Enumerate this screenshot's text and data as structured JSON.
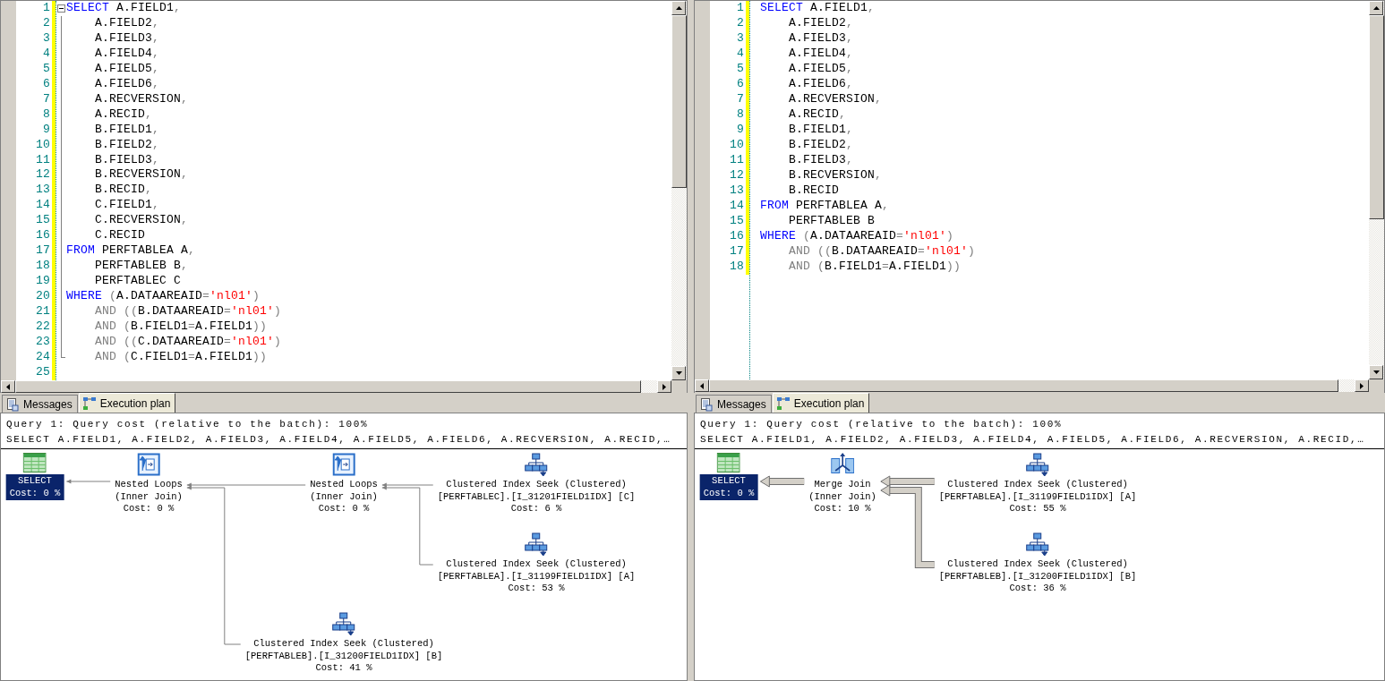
{
  "panes": [
    {
      "editor": {
        "outlining": true,
        "lines": [
          {
            "number": "1",
            "tokens": [
              {
                "kind": "keyword",
                "text": "SELECT"
              },
              {
                "kind": "identifier",
                "text": " A.FIELD1"
              },
              {
                "kind": "punctuation",
                "text": ","
              }
            ]
          },
          {
            "number": "2",
            "tokens": [
              {
                "kind": "identifier",
                "text": "    A.FIELD2"
              },
              {
                "kind": "punctuation",
                "text": ","
              }
            ]
          },
          {
            "number": "3",
            "tokens": [
              {
                "kind": "identifier",
                "text": "    A.FIELD3"
              },
              {
                "kind": "punctuation",
                "text": ","
              }
            ]
          },
          {
            "number": "4",
            "tokens": [
              {
                "kind": "identifier",
                "text": "    A.FIELD4"
              },
              {
                "kind": "punctuation",
                "text": ","
              }
            ]
          },
          {
            "number": "5",
            "tokens": [
              {
                "kind": "identifier",
                "text": "    A.FIELD5"
              },
              {
                "kind": "punctuation",
                "text": ","
              }
            ]
          },
          {
            "number": "6",
            "tokens": [
              {
                "kind": "identifier",
                "text": "    A.FIELD6"
              },
              {
                "kind": "punctuation",
                "text": ","
              }
            ]
          },
          {
            "number": "7",
            "tokens": [
              {
                "kind": "identifier",
                "text": "    A.RECVERSION"
              },
              {
                "kind": "punctuation",
                "text": ","
              }
            ]
          },
          {
            "number": "8",
            "tokens": [
              {
                "kind": "identifier",
                "text": "    A.RECID"
              },
              {
                "kind": "punctuation",
                "text": ","
              }
            ]
          },
          {
            "number": "9",
            "tokens": [
              {
                "kind": "identifier",
                "text": "    B.FIELD1"
              },
              {
                "kind": "punctuation",
                "text": ","
              }
            ]
          },
          {
            "number": "10",
            "tokens": [
              {
                "kind": "identifier",
                "text": "    B.FIELD2"
              },
              {
                "kind": "punctuation",
                "text": ","
              }
            ]
          },
          {
            "number": "11",
            "tokens": [
              {
                "kind": "identifier",
                "text": "    B.FIELD3"
              },
              {
                "kind": "punctuation",
                "text": ","
              }
            ]
          },
          {
            "number": "12",
            "tokens": [
              {
                "kind": "identifier",
                "text": "    B.RECVERSION"
              },
              {
                "kind": "punctuation",
                "text": ","
              }
            ]
          },
          {
            "number": "13",
            "tokens": [
              {
                "kind": "identifier",
                "text": "    B.RECID"
              },
              {
                "kind": "punctuation",
                "text": ","
              }
            ]
          },
          {
            "number": "14",
            "tokens": [
              {
                "kind": "identifier",
                "text": "    C.FIELD1"
              },
              {
                "kind": "punctuation",
                "text": ","
              }
            ]
          },
          {
            "number": "15",
            "tokens": [
              {
                "kind": "identifier",
                "text": "    C.RECVERSION"
              },
              {
                "kind": "punctuation",
                "text": ","
              }
            ]
          },
          {
            "number": "16",
            "tokens": [
              {
                "kind": "identifier",
                "text": "    C.RECID"
              }
            ]
          },
          {
            "number": "17",
            "tokens": [
              {
                "kind": "keyword",
                "text": "FROM"
              },
              {
                "kind": "identifier",
                "text": " PERFTABLEA A"
              },
              {
                "kind": "punctuation",
                "text": ","
              }
            ]
          },
          {
            "number": "18",
            "tokens": [
              {
                "kind": "identifier",
                "text": "    PERFTABLEB B"
              },
              {
                "kind": "punctuation",
                "text": ","
              }
            ]
          },
          {
            "number": "19",
            "tokens": [
              {
                "kind": "identifier",
                "text": "    PERFTABLEC C"
              }
            ]
          },
          {
            "number": "20",
            "tokens": [
              {
                "kind": "keyword",
                "text": "WHERE"
              },
              {
                "kind": "punctuation",
                "text": " ("
              },
              {
                "kind": "identifier",
                "text": "A.DATAAREAID"
              },
              {
                "kind": "punctuation",
                "text": "="
              },
              {
                "kind": "string",
                "text": "'nl01'"
              },
              {
                "kind": "punctuation",
                "text": ")"
              }
            ]
          },
          {
            "number": "21",
            "tokens": [
              {
                "kind": "operator",
                "text": "    AND"
              },
              {
                "kind": "punctuation",
                "text": " (("
              },
              {
                "kind": "identifier",
                "text": "B.DATAAREAID"
              },
              {
                "kind": "punctuation",
                "text": "="
              },
              {
                "kind": "string",
                "text": "'nl01'"
              },
              {
                "kind": "punctuation",
                "text": ")"
              }
            ]
          },
          {
            "number": "22",
            "tokens": [
              {
                "kind": "operator",
                "text": "    AND"
              },
              {
                "kind": "punctuation",
                "text": " ("
              },
              {
                "kind": "identifier",
                "text": "B.FIELD1"
              },
              {
                "kind": "punctuation",
                "text": "="
              },
              {
                "kind": "identifier",
                "text": "A.FIELD1"
              },
              {
                "kind": "punctuation",
                "text": "))"
              }
            ]
          },
          {
            "number": "23",
            "tokens": [
              {
                "kind": "operator",
                "text": "    AND"
              },
              {
                "kind": "punctuation",
                "text": " (("
              },
              {
                "kind": "identifier",
                "text": "C.DATAAREAID"
              },
              {
                "kind": "punctuation",
                "text": "="
              },
              {
                "kind": "string",
                "text": "'nl01'"
              },
              {
                "kind": "punctuation",
                "text": ")"
              }
            ]
          },
          {
            "number": "24",
            "tokens": [
              {
                "kind": "operator",
                "text": "    AND"
              },
              {
                "kind": "punctuation",
                "text": " ("
              },
              {
                "kind": "identifier",
                "text": "C.FIELD1"
              },
              {
                "kind": "punctuation",
                "text": "="
              },
              {
                "kind": "identifier",
                "text": "A.FIELD1"
              },
              {
                "kind": "punctuation",
                "text": "))"
              }
            ]
          },
          {
            "number": "25"
          }
        ]
      },
      "results": {
        "tabs": [
          {
            "label": "Messages",
            "kind": "messages",
            "selected": false
          },
          {
            "label": "Execution plan",
            "kind": "plan",
            "selected": true
          }
        ],
        "header": "Query 1: Query cost (relative to the batch): 100%",
        "statement": "SELECT A.FIELD1, A.FIELD2, A.FIELD3, A.FIELD4, A.FIELD5, A.FIELD6, A.RECVERSION, A.RECID,…",
        "plan": {
          "wide_arrows": false,
          "root": {
            "kind": "select",
            "lines": [
              "SELECT"
            ],
            "cost": "Cost: 0 %",
            "selected": true,
            "children": [
              {
                "kind": "nested_loops",
                "lines": [
                  "Nested Loops",
                  "(Inner Join)"
                ],
                "cost": "Cost: 0 %",
                "selected": false,
                "children": [
                  {
                    "kind": "nested_loops",
                    "lines": [
                      "Nested Loops",
                      "(Inner Join)"
                    ],
                    "cost": "Cost: 0 %",
                    "selected": false,
                    "children": [
                      {
                        "kind": "index_seek",
                        "lines": [
                          "Clustered Index Seek (Clustered)",
                          "[PERFTABLEC].[I_31201FIELD1IDX] [C]"
                        ],
                        "cost": "Cost: 6 %",
                        "selected": false
                      },
                      {
                        "kind": "index_seek",
                        "lines": [
                          "Clustered Index Seek (Clustered)",
                          "[PERFTABLEA].[I_31199FIELD1IDX] [A]"
                        ],
                        "cost": "Cost: 53 %",
                        "selected": false
                      }
                    ]
                  },
                  {
                    "kind": "index_seek",
                    "lines": [
                      "Clustered Index Seek (Clustered)",
                      "[PERFTABLEB].[I_31200FIELD1IDX] [B]"
                    ],
                    "cost": "Cost: 41 %",
                    "selected": false
                  }
                ]
              }
            ]
          }
        }
      }
    },
    {
      "editor": {
        "outlining": false,
        "lines": [
          {
            "number": "1",
            "tokens": [
              {
                "kind": "keyword",
                "text": "SELECT"
              },
              {
                "kind": "identifier",
                "text": " A.FIELD1"
              },
              {
                "kind": "punctuation",
                "text": ","
              }
            ]
          },
          {
            "number": "2",
            "tokens": [
              {
                "kind": "identifier",
                "text": "    A.FIELD2"
              },
              {
                "kind": "punctuation",
                "text": ","
              }
            ]
          },
          {
            "number": "3",
            "tokens": [
              {
                "kind": "identifier",
                "text": "    A.FIELD3"
              },
              {
                "kind": "punctuation",
                "text": ","
              }
            ]
          },
          {
            "number": "4",
            "tokens": [
              {
                "kind": "identifier",
                "text": "    A.FIELD4"
              },
              {
                "kind": "punctuation",
                "text": ","
              }
            ]
          },
          {
            "number": "5",
            "tokens": [
              {
                "kind": "identifier",
                "text": "    A.FIELD5"
              },
              {
                "kind": "punctuation",
                "text": ","
              }
            ]
          },
          {
            "number": "6",
            "tokens": [
              {
                "kind": "identifier",
                "text": "    A.FIELD6"
              },
              {
                "kind": "punctuation",
                "text": ","
              }
            ]
          },
          {
            "number": "7",
            "tokens": [
              {
                "kind": "identifier",
                "text": "    A.RECVERSION"
              },
              {
                "kind": "punctuation",
                "text": ","
              }
            ]
          },
          {
            "number": "8",
            "tokens": [
              {
                "kind": "identifier",
                "text": "    A.RECID"
              },
              {
                "kind": "punctuation",
                "text": ","
              }
            ]
          },
          {
            "number": "9",
            "tokens": [
              {
                "kind": "identifier",
                "text": "    B.FIELD1"
              },
              {
                "kind": "punctuation",
                "text": ","
              }
            ]
          },
          {
            "number": "10",
            "tokens": [
              {
                "kind": "identifier",
                "text": "    B.FIELD2"
              },
              {
                "kind": "punctuation",
                "text": ","
              }
            ]
          },
          {
            "number": "11",
            "tokens": [
              {
                "kind": "identifier",
                "text": "    B.FIELD3"
              },
              {
                "kind": "punctuation",
                "text": ","
              }
            ]
          },
          {
            "number": "12",
            "tokens": [
              {
                "kind": "identifier",
                "text": "    B.RECVERSION"
              },
              {
                "kind": "punctuation",
                "text": ","
              }
            ]
          },
          {
            "number": "13",
            "tokens": [
              {
                "kind": "identifier",
                "text": "    B.RECID"
              }
            ]
          },
          {
            "number": "14",
            "tokens": [
              {
                "kind": "keyword",
                "text": "FROM"
              },
              {
                "kind": "identifier",
                "text": " PERFTABLEA A"
              },
              {
                "kind": "punctuation",
                "text": ","
              }
            ]
          },
          {
            "number": "15",
            "tokens": [
              {
                "kind": "identifier",
                "text": "    PERFTABLEB B"
              }
            ]
          },
          {
            "number": "16",
            "tokens": [
              {
                "kind": "keyword",
                "text": "WHERE"
              },
              {
                "kind": "punctuation",
                "text": " ("
              },
              {
                "kind": "identifier",
                "text": "A.DATAAREAID"
              },
              {
                "kind": "punctuation",
                "text": "="
              },
              {
                "kind": "string",
                "text": "'nl01'"
              },
              {
                "kind": "punctuation",
                "text": ")"
              }
            ]
          },
          {
            "number": "17",
            "tokens": [
              {
                "kind": "operator",
                "text": "    AND"
              },
              {
                "kind": "punctuation",
                "text": " (("
              },
              {
                "kind": "identifier",
                "text": "B.DATAAREAID"
              },
              {
                "kind": "punctuation",
                "text": "="
              },
              {
                "kind": "string",
                "text": "'nl01'"
              },
              {
                "kind": "punctuation",
                "text": ")"
              }
            ]
          },
          {
            "number": "18",
            "tokens": [
              {
                "kind": "operator",
                "text": "    AND"
              },
              {
                "kind": "punctuation",
                "text": " ("
              },
              {
                "kind": "identifier",
                "text": "B.FIELD1"
              },
              {
                "kind": "punctuation",
                "text": "="
              },
              {
                "kind": "identifier",
                "text": "A.FIELD1"
              },
              {
                "kind": "punctuation",
                "text": "))"
              }
            ]
          }
        ]
      },
      "results": {
        "tabs": [
          {
            "label": "Messages",
            "kind": "messages",
            "selected": false
          },
          {
            "label": "Execution plan",
            "kind": "plan",
            "selected": true
          }
        ],
        "header": "Query 1: Query cost (relative to the batch): 100%",
        "statement": "SELECT A.FIELD1, A.FIELD2, A.FIELD3, A.FIELD4, A.FIELD5, A.FIELD6, A.RECVERSION, A.RECID,…",
        "plan": {
          "wide_arrows": true,
          "root": {
            "kind": "select",
            "lines": [
              "SELECT"
            ],
            "cost": "Cost: 0 %",
            "selected": true,
            "children": [
              {
                "kind": "merge_join",
                "lines": [
                  "Merge Join",
                  "(Inner Join)"
                ],
                "cost": "Cost: 10 %",
                "selected": false,
                "children": [
                  {
                    "kind": "index_seek",
                    "lines": [
                      "Clustered Index Seek (Clustered)",
                      "[PERFTABLEA].[I_31199FIELD1IDX] [A]"
                    ],
                    "cost": "Cost: 55 %",
                    "selected": false
                  },
                  {
                    "kind": "index_seek",
                    "lines": [
                      "Clustered Index Seek (Clustered)",
                      "[PERFTABLEB].[I_31200FIELD1IDX] [B]"
                    ],
                    "cost": "Cost: 36 %",
                    "selected": false
                  }
                ]
              }
            ]
          }
        }
      }
    }
  ]
}
